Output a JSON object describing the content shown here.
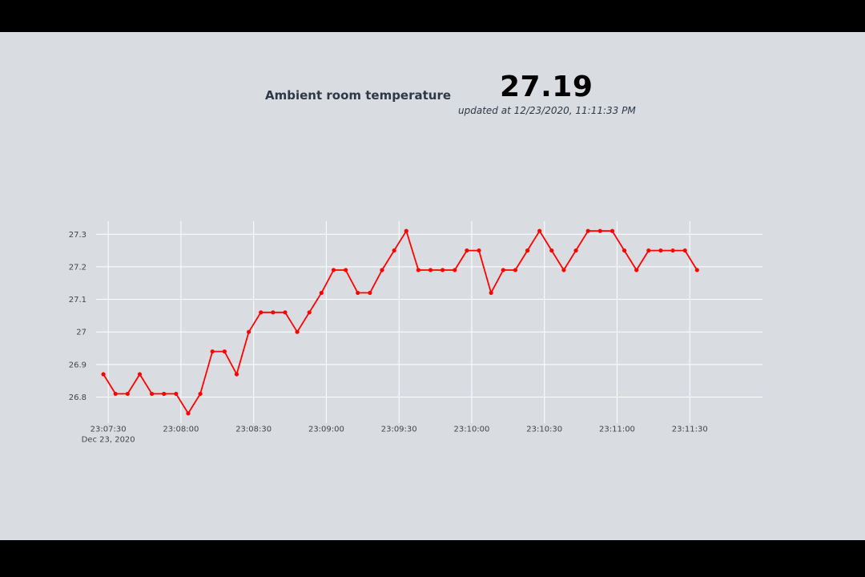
{
  "header": {
    "title": "Ambient room temperature",
    "value": "27.19",
    "updated": "updated at 12/23/2020, 11:11:33 PM"
  },
  "colors": {
    "background": "#d9dde1",
    "line": "#ff0000",
    "grid": "#ffffff",
    "letterbox": "#000000"
  },
  "chart_data": {
    "type": "line",
    "grid": true,
    "legend": "none",
    "xlim": [
      "2020-12-23 23:07:25",
      "2020-12-23 23:12:00"
    ],
    "ylim": [
      26.72,
      27.34
    ],
    "x_ticks": [
      {
        "t": "2020-12-23 23:07:30",
        "label": "23:07:30",
        "sublabel": "Dec 23, 2020"
      },
      {
        "t": "2020-12-23 23:08:00",
        "label": "23:08:00"
      },
      {
        "t": "2020-12-23 23:08:30",
        "label": "23:08:30"
      },
      {
        "t": "2020-12-23 23:09:00",
        "label": "23:09:00"
      },
      {
        "t": "2020-12-23 23:09:30",
        "label": "23:09:30"
      },
      {
        "t": "2020-12-23 23:10:00",
        "label": "23:10:00"
      },
      {
        "t": "2020-12-23 23:10:30",
        "label": "23:10:30"
      },
      {
        "t": "2020-12-23 23:11:00",
        "label": "23:11:00"
      },
      {
        "t": "2020-12-23 23:11:30",
        "label": "23:11:30"
      }
    ],
    "y_ticks": [
      {
        "v": 26.8,
        "label": "26.8"
      },
      {
        "v": 26.9,
        "label": "26.9"
      },
      {
        "v": 27.0,
        "label": "27"
      },
      {
        "v": 27.1,
        "label": "27.1"
      },
      {
        "v": 27.2,
        "label": "27.2"
      },
      {
        "v": 27.3,
        "label": "27.3"
      }
    ],
    "series": [
      {
        "x": [
          "2020-12-23 23:07:28",
          "2020-12-23 23:07:33",
          "2020-12-23 23:07:38",
          "2020-12-23 23:07:43",
          "2020-12-23 23:07:48",
          "2020-12-23 23:07:53",
          "2020-12-23 23:07:58",
          "2020-12-23 23:08:03",
          "2020-12-23 23:08:08",
          "2020-12-23 23:08:13",
          "2020-12-23 23:08:18",
          "2020-12-23 23:08:23",
          "2020-12-23 23:08:28",
          "2020-12-23 23:08:33",
          "2020-12-23 23:08:38",
          "2020-12-23 23:08:43",
          "2020-12-23 23:08:48",
          "2020-12-23 23:08:53",
          "2020-12-23 23:08:58",
          "2020-12-23 23:09:03",
          "2020-12-23 23:09:08",
          "2020-12-23 23:09:13",
          "2020-12-23 23:09:18",
          "2020-12-23 23:09:23",
          "2020-12-23 23:09:28",
          "2020-12-23 23:09:33",
          "2020-12-23 23:09:38",
          "2020-12-23 23:09:43",
          "2020-12-23 23:09:48",
          "2020-12-23 23:09:53",
          "2020-12-23 23:09:58",
          "2020-12-23 23:10:03",
          "2020-12-23 23:10:08",
          "2020-12-23 23:10:13",
          "2020-12-23 23:10:18",
          "2020-12-23 23:10:23",
          "2020-12-23 23:10:28",
          "2020-12-23 23:10:33",
          "2020-12-23 23:10:38",
          "2020-12-23 23:10:43",
          "2020-12-23 23:10:48",
          "2020-12-23 23:10:53",
          "2020-12-23 23:10:58",
          "2020-12-23 23:11:03",
          "2020-12-23 23:11:08",
          "2020-12-23 23:11:13",
          "2020-12-23 23:11:18",
          "2020-12-23 23:11:23",
          "2020-12-23 23:11:28",
          "2020-12-23 23:11:33"
        ],
        "y": [
          26.87,
          26.81,
          26.81,
          26.87,
          26.81,
          26.81,
          26.81,
          26.75,
          26.81,
          26.94,
          26.94,
          26.87,
          27.0,
          27.06,
          27.06,
          27.06,
          27.0,
          27.06,
          27.12,
          27.19,
          27.19,
          27.12,
          27.12,
          27.19,
          27.25,
          27.31,
          27.19,
          27.19,
          27.19,
          27.19,
          27.25,
          27.25,
          27.12,
          27.19,
          27.19,
          27.25,
          27.31,
          27.25,
          27.19,
          27.25,
          27.31,
          27.31,
          27.31,
          27.25,
          27.19,
          27.25,
          27.25,
          27.25,
          27.25,
          27.19
        ]
      }
    ]
  }
}
